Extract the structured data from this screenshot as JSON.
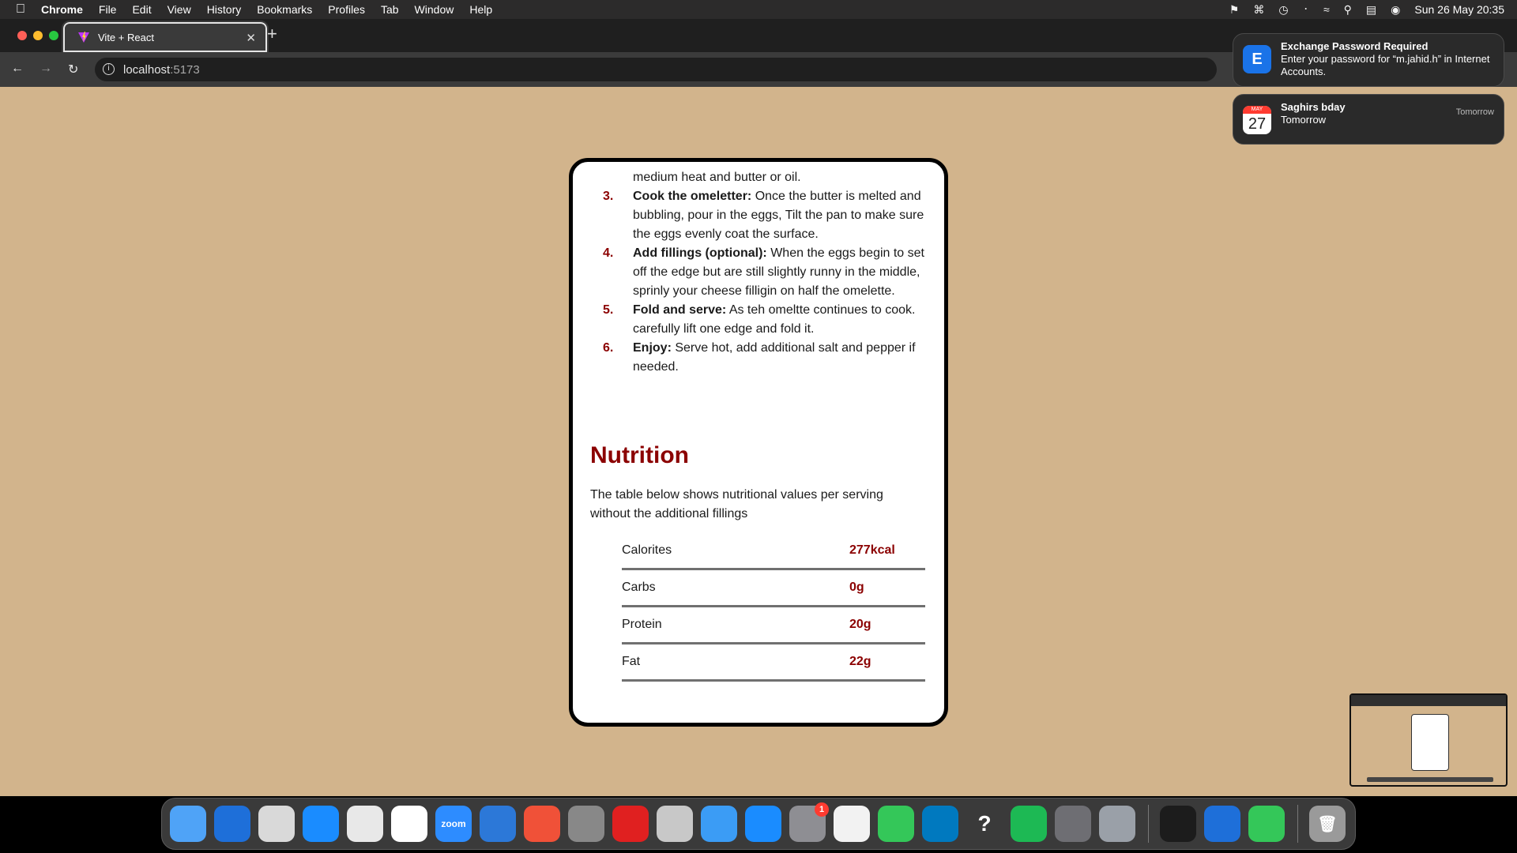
{
  "menubar": {
    "app_name": "Chrome",
    "menus": [
      "File",
      "Edit",
      "View",
      "History",
      "Bookmarks",
      "Profiles",
      "Tab",
      "Window",
      "Help"
    ],
    "datetime": "Sun 26 May  20:35"
  },
  "browser": {
    "tab_title": "Vite + React",
    "url_host": "localhost",
    "url_port": ":5173"
  },
  "recipe": {
    "cut_text": "medium heat and butter or oil.",
    "steps": [
      {
        "num": "3.",
        "title": "Cook the omeletter:",
        "text": " Once the butter is melted and bubbling, pour in the eggs, Tilt the pan to make sure the eggs evenly coat the surface."
      },
      {
        "num": "4.",
        "title": "Add fillings (optional):",
        "text": " When the eggs begin to set off the edge but are still slightly runny in the middle, sprinly your cheese filligin on half the omelette."
      },
      {
        "num": "5.",
        "title": "Fold and serve:",
        "text": " As teh omeltte continues to cook. carefully lift one edge and fold it."
      },
      {
        "num": "6.",
        "title": "Enjoy:",
        "text": " Serve hot, add additional salt and pepper if needed."
      }
    ],
    "nutrition_title": "Nutrition",
    "nutrition_desc": "The table below shows nutritional values per serving without the additional fillings",
    "nutrition": [
      {
        "label": "Calorites",
        "value": "277kcal"
      },
      {
        "label": "Carbs",
        "value": "0g"
      },
      {
        "label": "Protein",
        "value": "20g"
      },
      {
        "label": "Fat",
        "value": "22g"
      }
    ]
  },
  "notifications": [
    {
      "title": "Exchange Password Required",
      "body": "Enter your password for “m.jahid.h” in Internet Accounts.",
      "time": ""
    },
    {
      "title": "Saghirs bday",
      "body": "Tomorrow",
      "time": "Tomorrow",
      "cal_month": "MAY",
      "cal_day": "27"
    }
  ],
  "dock": {
    "apps": [
      {
        "name": "finder",
        "color": "#4fa3f7"
      },
      {
        "name": "vscode",
        "color": "#1e6fd9"
      },
      {
        "name": "keyboard",
        "color": "#d9d9d9"
      },
      {
        "name": "safari",
        "color": "#1a8cff"
      },
      {
        "name": "chrome",
        "color": "#e8e8e8"
      },
      {
        "name": "slack",
        "color": "#ffffff"
      },
      {
        "name": "zoom",
        "color": "#2d8cff",
        "label": "zoom"
      },
      {
        "name": "xcode",
        "color": "#2c78d8"
      },
      {
        "name": "swift",
        "color": "#f05138"
      },
      {
        "name": "compressor",
        "color": "#888888"
      },
      {
        "name": "downloader",
        "color": "#e02020"
      },
      {
        "name": "storage",
        "color": "#c8c8c8"
      },
      {
        "name": "mail",
        "color": "#3b9cf5"
      },
      {
        "name": "app-store",
        "color": "#1a8cff"
      },
      {
        "name": "settings",
        "color": "#8e8e93",
        "badge": "1"
      },
      {
        "name": "textedit",
        "color": "#f2f2f2"
      },
      {
        "name": "facetime",
        "color": "#34c759"
      },
      {
        "name": "trello",
        "color": "#0079bf"
      },
      {
        "name": "help",
        "color": "#3a3a3a",
        "label": "?"
      },
      {
        "name": "spotify",
        "color": "#1db954"
      },
      {
        "name": "accessibility",
        "color": "#6e6e73"
      },
      {
        "name": "system-prefs",
        "color": "#9aa0a8"
      }
    ],
    "apps_right": [
      {
        "name": "terminal",
        "color": "#1c1c1c"
      },
      {
        "name": "vscode-2",
        "color": "#1e6fd9"
      },
      {
        "name": "messages",
        "color": "#34c759"
      }
    ]
  }
}
